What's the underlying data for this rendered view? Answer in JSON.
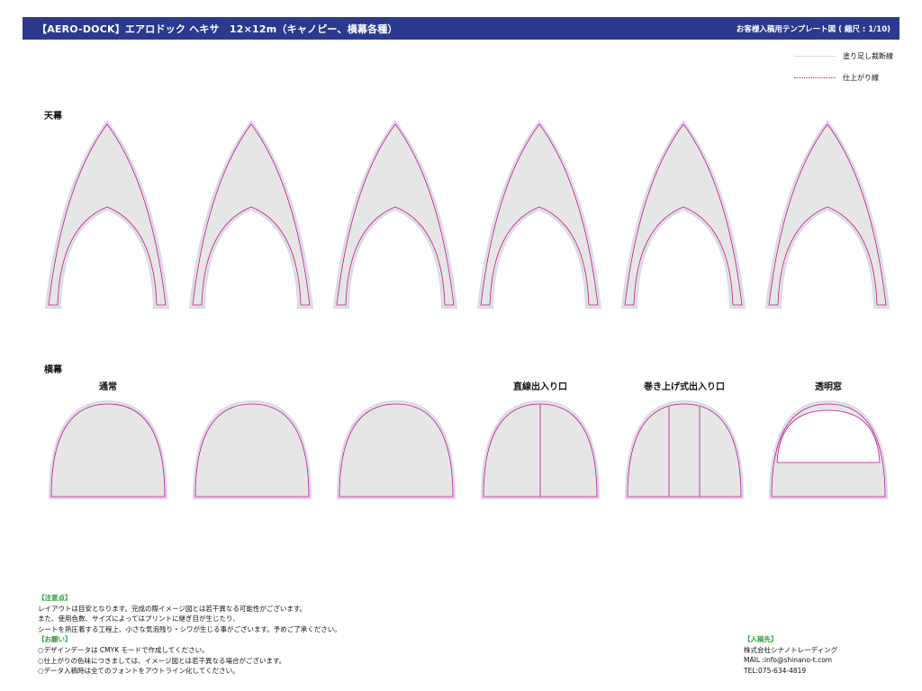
{
  "header": {
    "title": "【AERO-DOCK】エアロドック ヘキサ　12×12m（キャノピー、横幕各種）",
    "template_note": "お客様入稿用テンプレート図 ( 縮尺 : 1/10)"
  },
  "legend": {
    "bleed_label": "塗り足し裁断線",
    "finish_label": "仕上がり線"
  },
  "sections": {
    "canopy_label": "天幕",
    "side_label": "横幕"
  },
  "side_columns": {
    "normal": "通常",
    "straight_door": "直線出入り口",
    "rollup_door": "巻き上げ式出入り口",
    "window": "透明窓"
  },
  "notes": {
    "caution_head": "【注意点】",
    "caution_lines": [
      "レイアウトは目安となります。完成の際イメージ図とは若干異なる可能性がございます。",
      "また、使用色数、サイズによってはプリントに継ぎ目が生じたり、",
      "シートを熱圧着する工程上、小さな気泡残り・シワが生じる事がございます。予めご了承ください。"
    ],
    "request_head": "【お願い】",
    "request_lines": [
      "○デザインデータは CMYK モードで作成してください。",
      "○仕上がりの色味につきましては、イメージ図とは若干異なる場合がございます。",
      "○データ入稿時は全てのフォントをアウトライン化してください。"
    ]
  },
  "contact": {
    "head": "【入稿先】",
    "company": "株式会社シナノトレーディング",
    "mail": "MAIL :info@shinano-t.com",
    "tel": "TEL:075-634-4819"
  },
  "colors": {
    "header_bg": "#2b3a8f",
    "panel_fill": "#e6e6e6",
    "finish_line": "#c2158f",
    "bleed_line": "#d8dbe8",
    "note_heading": "#2e9e3a"
  }
}
